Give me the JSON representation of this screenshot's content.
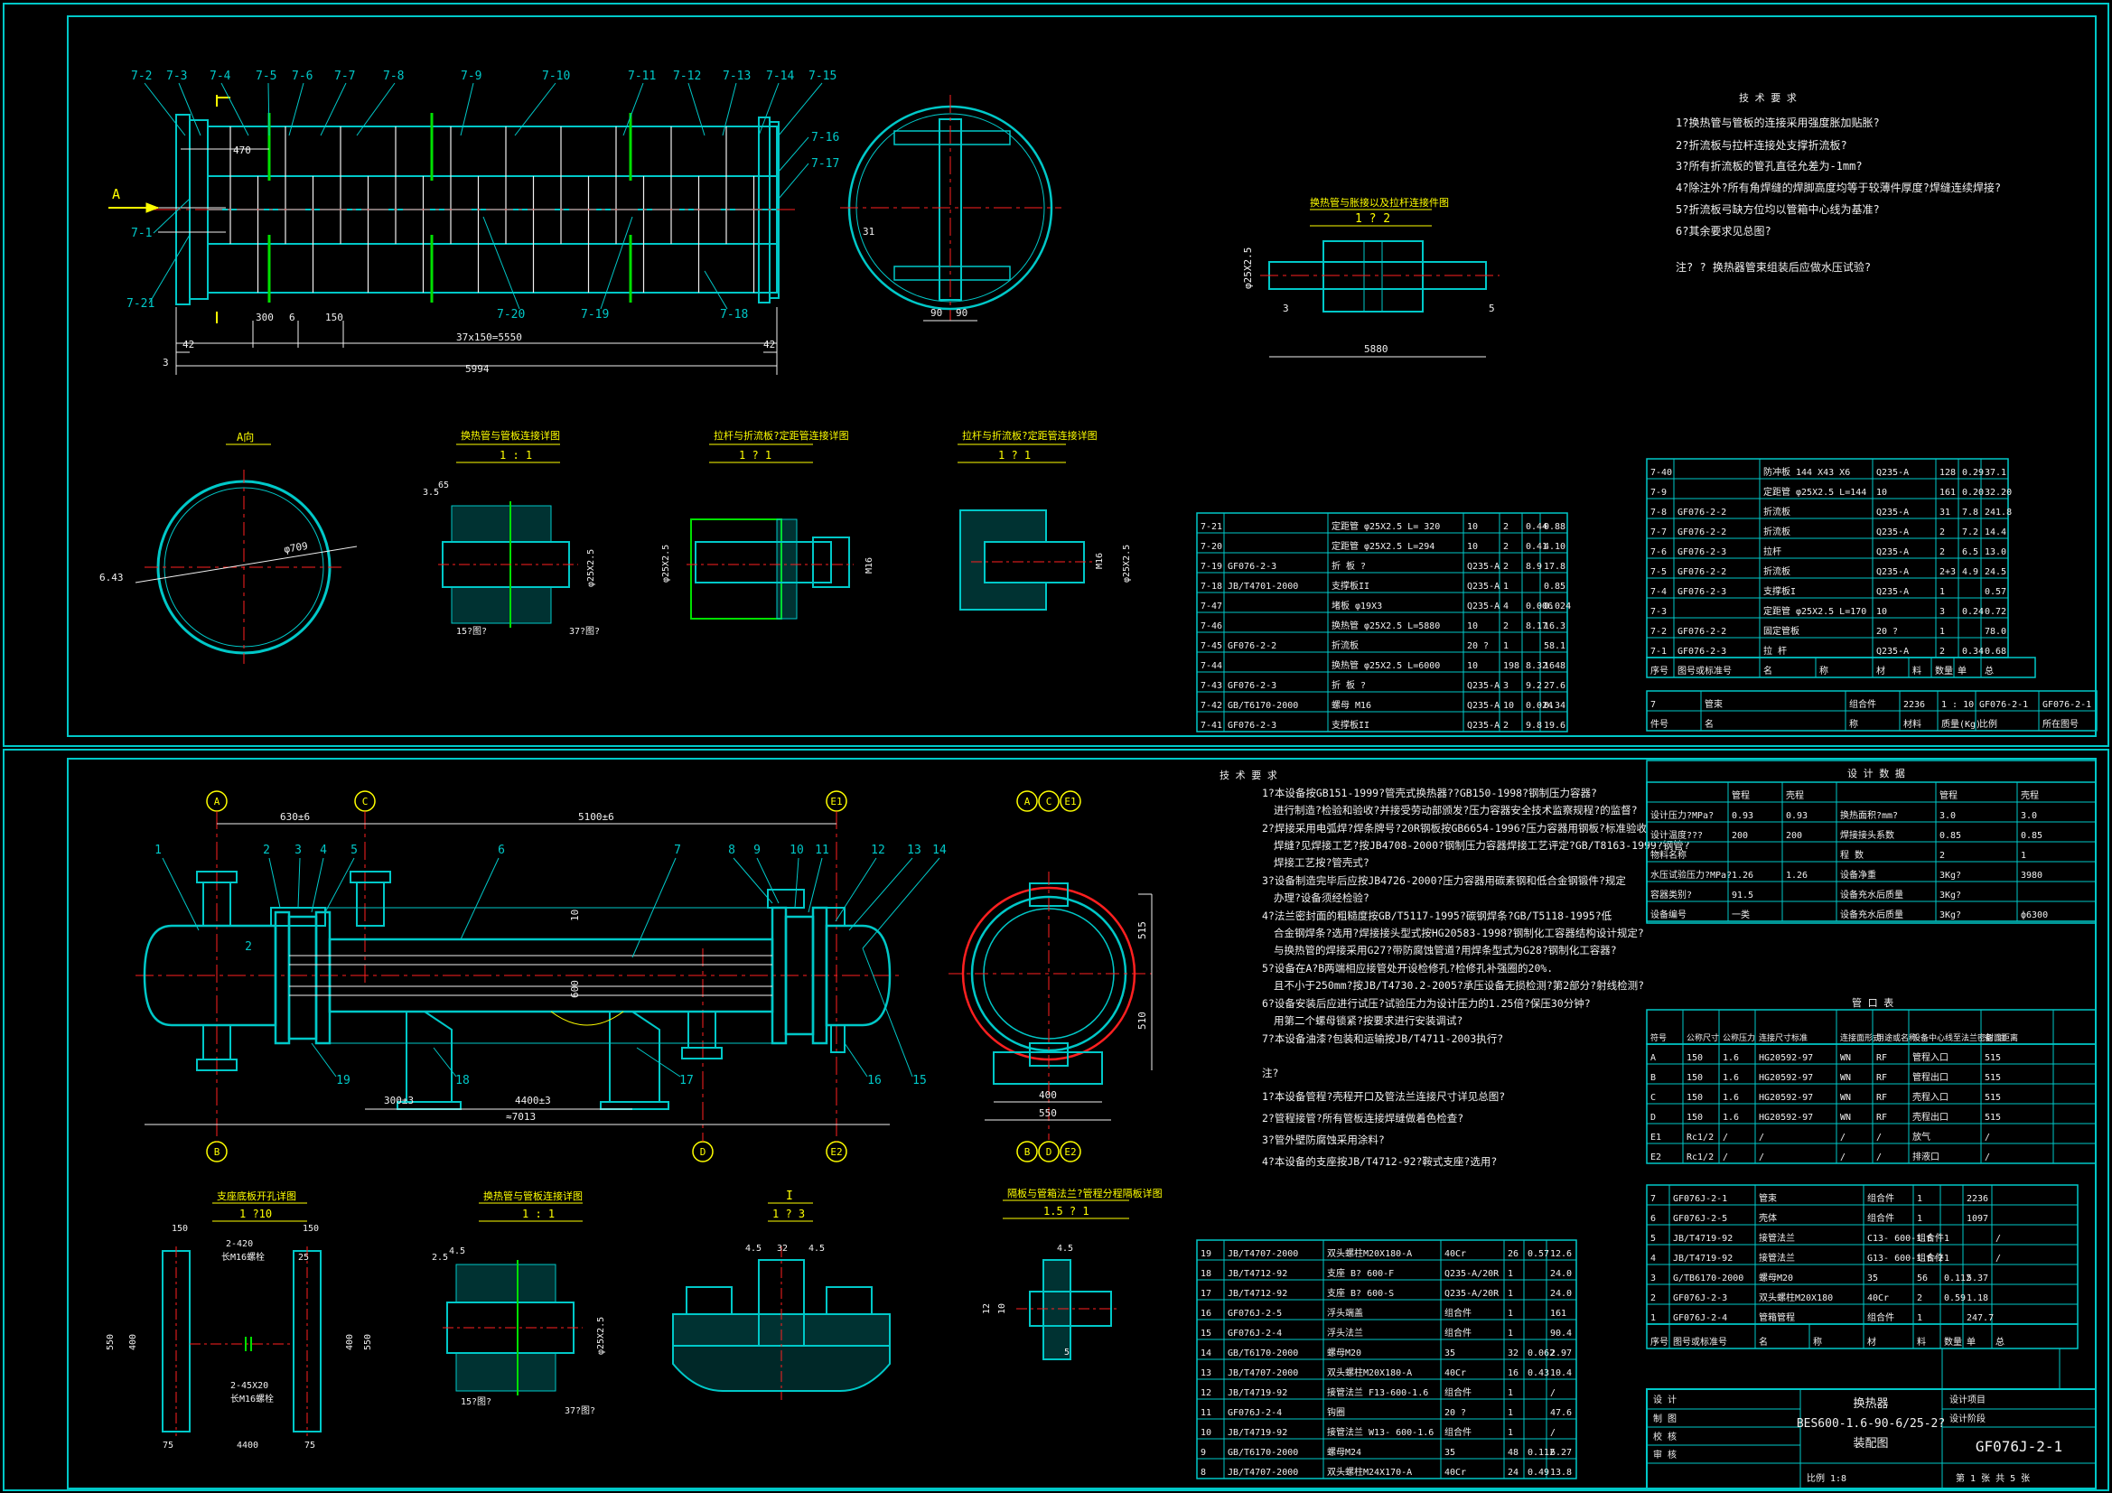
{
  "colors": {
    "frame": "#00c8c8",
    "red": "#ff2020",
    "white": "#f0f0f0",
    "yellow": "#ffff00",
    "green": "#00e000",
    "magenta": "#ff40ff",
    "orange": "#ff8000"
  },
  "top": {
    "bundle_labels": [
      "7-2",
      "7-3",
      "7-4",
      "7-5",
      "7-6",
      "7-7",
      "7-8",
      "7-9",
      "7-10",
      "7-11",
      "7-12",
      "7-13",
      "7-14",
      "7-15",
      "7-16",
      "7-17",
      "7-1",
      "7-21",
      "7-20",
      "7-19",
      "7-18"
    ],
    "bundle_dims": {
      "d1": "470",
      "d2": "300",
      "d3": "6",
      "d4": "150",
      "d5": "37x150=5550",
      "d6": "5994",
      "d7": "42",
      "d8": "42",
      "d9": "3"
    },
    "end_view": {
      "callout": "31",
      "d90a": "90",
      "d90b": "90"
    },
    "pipe_view": {
      "title": "换热管与胀接以及拉杆连接件图",
      "scale": "1 ? 2",
      "dia": "φ25X2.5",
      "len": "5880",
      "n3": "3",
      "n5": "5"
    },
    "tech_title": "技 术 要 求",
    "tech_lines": [
      "1?换热管与管板的连接采用强度胀加贴胀?",
      "2?折流板与拉杆连接处支撑折流板?",
      "3?所有折流板的管孔直径允差为-1mm?",
      "4?除注外?所有角焊缝的焊脚高度均等于较薄件厚度?焊缝连续焊接?",
      "5?折流板弓缺方位均以管箱中心线为基准?",
      "6?其余要求见总图?"
    ],
    "tech_note": "注? ? 换热器管束组装后应做水压试验?",
    "view_A": {
      "title": "A向",
      "dia": "φ709",
      "d643": "6.43"
    },
    "det1": {
      "title": "换热管与管板连接详图",
      "scale": "1 : 1",
      "d35": "3.5",
      "d65": "65",
      "dia": "φ25X2.5",
      "lbl1": "15?图?",
      "lbl2": "37?图?"
    },
    "det2": {
      "title": "拉杆与折流板?定距管连接详图",
      "scale": "1 ? 1",
      "dia": "φ25X2.5",
      "m16": "M16"
    },
    "det3": {
      "title": "拉杆与折流板?定距管连接详图",
      "scale": "1 ? 1",
      "dia": "φ25X2.5",
      "m16": "M16"
    },
    "view_A_marker": "A",
    "bom_left": [
      [
        "7-21",
        "",
        "定距管 φ25X2.5  L= 320",
        "10",
        "2",
        "0.44",
        "0.88"
      ],
      [
        "7-20",
        "",
        "定距管 φ25X2.5  L=294",
        "10",
        "2",
        "0.41",
        "4.10"
      ],
      [
        "7-19",
        "GF076-2-3",
        "折 板 ?",
        "Q235-A",
        "2",
        "8.9",
        "17.8"
      ],
      [
        "7-18",
        "JB/T4701-2000",
        "支撑板II",
        "Q235-A",
        "1",
        "",
        "0.85"
      ],
      [
        "7-47",
        "",
        "堵板 φ19X3",
        "Q235-A",
        "4",
        "0.006",
        "0.024"
      ],
      [
        "7-46",
        "",
        "换热管 φ25X2.5  L=5880",
        "10",
        "2",
        "8.17",
        "16.3"
      ],
      [
        "7-45",
        "GF076-2-2",
        "折流板",
        "20 ?",
        "1",
        "",
        "58.1"
      ],
      [
        "7-44",
        "",
        "换热管 φ25X2.5  L=6000",
        "10",
        "198",
        "8.32",
        "1648"
      ],
      [
        "7-43",
        "GF076-2-3",
        "折 板 ?",
        "Q235-A",
        "3",
        "9.2",
        "27.6"
      ],
      [
        "7-42",
        "GB/T6170-2000",
        "螺母 M16",
        "Q235-A",
        "10",
        "0.024",
        "0.34"
      ],
      [
        "7-41",
        "GF076-2-3",
        "支撑板II",
        "Q235-A",
        "2",
        "9.8",
        "19.6"
      ]
    ],
    "bom_right": [
      [
        "7-40",
        "",
        "防冲板 144 X43 X6",
        "Q235-A",
        "128",
        "0.29",
        "37.1"
      ],
      [
        "7-9",
        "",
        "定距管 φ25X2.5  L=144",
        "10",
        "161",
        "0.20",
        "32.20"
      ],
      [
        "7-8",
        "GF076-2-2",
        "折流板",
        "Q235-A",
        "31",
        "7.8",
        "241.8"
      ],
      [
        "7-7",
        "GF076-2-2",
        "折流板",
        "Q235-A",
        "2",
        "7.2",
        "14.4"
      ],
      [
        "7-6",
        "GF076-2-3",
        "拉杆",
        "Q235-A",
        "2",
        "6.5",
        "13.0"
      ],
      [
        "7-5",
        "GF076-2-2",
        "折流板",
        "Q235-A",
        "2+3",
        "4.9",
        "24.5"
      ],
      [
        "7-4",
        "GF076-2-3",
        "支撑板I",
        "Q235-A",
        "1",
        "",
        "0.57"
      ],
      [
        "7-3",
        "",
        "定距管 φ25X2.5  L=170",
        "10",
        "3",
        "0.24",
        "0.72"
      ],
      [
        "7-2",
        "GF076-2-2",
        "固定管板",
        "20 ?",
        "1",
        "",
        "78.0"
      ],
      [
        "7-1",
        "GF076-2-3",
        "拉 杆",
        "Q235-A",
        "2",
        "0.34",
        "0.68"
      ]
    ],
    "bom_header": [
      "序号",
      "图号或标准号",
      "名",
      "称",
      "材",
      "料",
      "数量",
      "单",
      "总",
      "备",
      "注"
    ],
    "title_row": [
      "7",
      "管束",
      "组合件",
      "2236",
      "1 : 10",
      "GF076-2-1",
      "GF076-2-1"
    ],
    "title_hdr": [
      "件号",
      "名",
      "称",
      "材料",
      "质量(Kg)",
      "比例",
      "所在图号",
      "装配图号"
    ]
  },
  "bottom": {
    "grid_bubbles": [
      "A",
      "C",
      "E1",
      "B",
      "D",
      "E2",
      "A",
      "C",
      "E1",
      "B",
      "D",
      "E2"
    ],
    "part_nums": [
      "1",
      "2",
      "3",
      "4",
      "5",
      "6",
      "7",
      "8",
      "9",
      "10",
      "11",
      "12",
      "13",
      "14",
      "2",
      "19",
      "18",
      "17",
      "16",
      "15"
    ],
    "dims": {
      "d630": "630±6",
      "d5100": "5100±6",
      "d300": "300±3",
      "d4400": "4400±3",
      "d7013": "≈7013",
      "d10": "10",
      "d600": "600",
      "d515": "515",
      "d510": "510",
      "d400": "400",
      "d550": "550"
    },
    "tech_title": "技 术 要 求",
    "tech_lines": [
      "1?本设备按GB151-1999?管壳式换热器??GB150-1998?钢制压力容器?",
      "进行制造?检验和验收?并接受劳动部颁发?压力容器安全技术监察规程?的监督?",
      "2?焊接采用电弧焊?焊条牌号?20R钢板按GB6654-1996?压力容器用钢板?标准验收",
      "焊缝?见焊接工艺?按JB4708-2000?钢制压力容器焊接工艺评定?GB/T8163-1999?钢管?",
      "焊接工艺按?管壳式?",
      "3?设备制造完毕后应按JB4726-2000?压力容器用碳素钢和低合金钢锻件?规定",
      "办理?设备须经检验?",
      "4?法兰密封面的粗糙度按GB/T5117-1995?碳钢焊条?GB/T5118-1995?低",
      "合金钢焊条?选用?焊接接头型式按HG20583-1998?钢制化工容器结构设计规定?",
      "与换热管的焊接采用G27?带防腐蚀管道?用焊条型式为G28?钢制化工容器?",
      "5?设备在A?B两端相应接管处开设检修孔?检修孔补强圈的20%.",
      "且不小于250mm?按JB/T4730.2-2005?承压设备无损检测?第2部分?射线检测?",
      "6?设备安装后应进行试压?试验压力为设计压力的1.25倍?保压30分钟?",
      "用第二个螺母锁紧?按要求进行安装调试?",
      "7?本设备油漆?包装和运输按JB/T4711-2003执行?"
    ],
    "notes_title": "注?",
    "notes": [
      "1?本设备管程?壳程开口及管法兰连接尺寸详见总图?",
      "2?管程接管?所有管板连接焊缝做着色检查?",
      "3?管外壁防腐蚀采用涂料?",
      "4?本设备的支座按JB/T4712-92?鞍式支座?选用?"
    ],
    "end_view_bubbles": [
      "A",
      "C",
      "E1",
      "B",
      "D",
      "E2"
    ],
    "design_title": "设 计 数 据",
    "design_head": [
      "",
      "管程",
      "壳程",
      "",
      "管程",
      "壳程"
    ],
    "design_rows": [
      [
        "设计压力?MPa?",
        "0.93",
        "0.93",
        "换热面积?mm?",
        "3.0",
        "3.0"
      ],
      [
        "设计温度???",
        "200",
        "200",
        "焊接接头系数",
        "0.85",
        "0.85"
      ],
      [
        "物料名称",
        "",
        "",
        "程 数",
        "2",
        "1"
      ],
      [
        "水压试验压力?MPa?",
        "1.26",
        "1.26",
        "设备净重",
        "3Kg?",
        "3980"
      ],
      [
        "容器类别?",
        "91.5",
        "",
        "设备充水后质量",
        "3Kg?",
        ""
      ],
      [
        "设备编号",
        "一类",
        "",
        "设备充水后质量",
        "3Kg?",
        "ф6300"
      ]
    ],
    "nozzle_title": "管 口 表",
    "nozzle_head": [
      "符号",
      "公称尺寸",
      "公称压力",
      "连接尺寸标准",
      "连接面形式",
      "用途或名称",
      "设备中心线至法兰密封面距离",
      "备 注"
    ],
    "nozzle_rows": [
      [
        "A",
        "150",
        "1.6",
        "HG20592-97",
        "WN",
        "RF",
        "管程入口",
        "515",
        ""
      ],
      [
        "B",
        "150",
        "1.6",
        "HG20592-97",
        "WN",
        "RF",
        "管程出口",
        "515",
        ""
      ],
      [
        "C",
        "150",
        "1.6",
        "HG20592-97",
        "WN",
        "RF",
        "壳程入口",
        "515",
        ""
      ],
      [
        "D",
        "150",
        "1.6",
        "HG20592-97",
        "WN",
        "RF",
        "壳程出口",
        "515",
        ""
      ],
      [
        "E1",
        "Rc1/2",
        "/",
        "/",
        "/",
        "/",
        "放气",
        "/",
        ""
      ],
      [
        "E2",
        "Rc1/2",
        "/",
        "/",
        "/",
        "/",
        "排液口",
        "/",
        ""
      ]
    ],
    "bom_right": [
      [
        "7",
        "GF076J-2-1",
        "管束",
        "组合件",
        "1",
        "",
        "2236",
        ""
      ],
      [
        "6",
        "GF076J-2-5",
        "壳体",
        "组合件",
        "1",
        "",
        "1097",
        ""
      ],
      [
        "5",
        "JB/T4719-92",
        "接管法兰",
        "C13- 600-1.6",
        "组合件",
        "1",
        "",
        "/"
      ],
      [
        "4",
        "JB/T4719-92",
        "接管法兰",
        "G13- 600-1.6-2",
        "组合件",
        "1",
        "",
        "/"
      ],
      [
        "3",
        "G/TB6170-2000",
        "螺母M20",
        "35",
        "56",
        "0.112",
        "5.37",
        ""
      ],
      [
        "2",
        "GF076J-2-3",
        "双头螺柱M20X180",
        "40Cr",
        "2",
        "0.59",
        "1.18",
        ""
      ],
      [
        "1",
        "GF076J-2-4",
        "管箱管程",
        "组合件",
        "1",
        "",
        "247.7",
        ""
      ]
    ],
    "bom_right_head": [
      "序号",
      "图号或标准号",
      "名",
      "称",
      "材",
      "料",
      "数量",
      "单",
      "总",
      "备",
      "注"
    ],
    "bom_left": [
      [
        "19",
        "JB/T4707-2000",
        "双头螺柱M20X180-A",
        "40Cr",
        "26",
        "0.57",
        "12.6"
      ],
      [
        "18",
        "JB/T4712-92",
        "支座 B? 600-F",
        "Q235-A/20R",
        "1",
        "",
        "24.0"
      ],
      [
        "17",
        "JB/T4712-92",
        "支座 B? 600-S",
        "Q235-A/20R",
        "1",
        "",
        "24.0"
      ],
      [
        "16",
        "GF076J-2-5",
        "浮头端盖",
        "组合件",
        "1",
        "",
        "161"
      ],
      [
        "15",
        "GF076J-2-4",
        "浮头法兰",
        "组合件",
        "1",
        "",
        "90.4"
      ],
      [
        "14",
        "GB/T6170-2000",
        "螺母M20",
        "35",
        "32",
        "0.062",
        "2.97"
      ],
      [
        "13",
        "JB/T4707-2000",
        "双头螺柱M20X180-A",
        "40Cr",
        "16",
        "0.43",
        "10.4"
      ],
      [
        "12",
        "JB/T4719-92",
        "接管法兰  F13-600-1.6",
        "组合件",
        "1",
        "",
        "/"
      ],
      [
        "11",
        "GF076J-2-4",
        "钩圈",
        "20 ?",
        "1",
        "",
        "47.6"
      ],
      [
        "10",
        "JB/T4719-92",
        "接管法兰  W13- 600-1.6",
        "组合件",
        "1",
        "",
        "/"
      ],
      [
        "9",
        "GB/T6170-2000",
        "螺母M24",
        "35",
        "48",
        "0.112",
        "6.27"
      ],
      [
        "8",
        "JB/T4707-2000",
        "双头螺柱M24X170-A",
        "40Cr",
        "24",
        "0.49",
        "13.8"
      ]
    ],
    "title_block": {
      "name1": "换热器",
      "name2": "BES600-1.6-90-6/25-2?",
      "name3": "装配图",
      "dwg": "GF076J-2-1",
      "proj1": "设计项目",
      "proj2": "设计阶段",
      "scale": "比例 1:8",
      "sheet": "第 1 张  共 5 张",
      "roles": [
        "设 计",
        "制 图",
        "校 核",
        "审 核"
      ]
    },
    "det_support": {
      "title": "支座底板开孔详图",
      "scale": "1 ?10",
      "d150a": "150",
      "d150b": "150",
      "d25": "25",
      "d2420": "2-420",
      "lbl1": "长M16螺栓",
      "d550a": "550",
      "d400a": "400",
      "d400b": "400",
      "d550b": "550",
      "d75a": "75",
      "d4400": "4400",
      "d75b": "75",
      "d2520": "2-45X20",
      "lbl2": "长M16螺栓"
    },
    "det_tube": {
      "title": "换热管与管板连接详图",
      "scale": "1 : 1",
      "d25": "2.5",
      "d45": "4.5",
      "dia": "φ25X2.5",
      "lbl1": "15?图?",
      "lbl2": "37?图?"
    },
    "det_I": {
      "title": "I",
      "scale": "1 ? 3",
      "d45a": "4.5",
      "d32": "32",
      "d45b": "4.5"
    },
    "det_rod": {
      "title": "隔板与管箱法兰?管程分程隔板详图",
      "scale": "1.5 ? 1",
      "d45": "4.5",
      "d12": "12",
      "d10": "10",
      "d5": "5"
    }
  }
}
